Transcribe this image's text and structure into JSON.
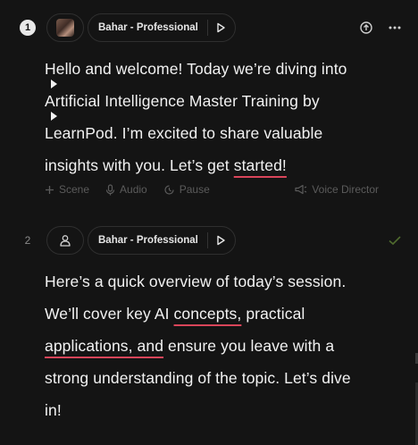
{
  "segments": [
    {
      "number": "1",
      "voice_label": "Bahar - Professional",
      "text_lines": [
        "Hello and welcome! Today we’re diving into",
        "Artificial Intelligence Master Training by",
        "LearnPod. I’m excited to share valuable",
        "insights with you. Let’s get "
      ],
      "underlined_word": "started!",
      "toolbar": {
        "scene_label": "Scene",
        "audio_label": "Audio",
        "pause_label": "Pause",
        "voice_director_label": "Voice Director"
      }
    },
    {
      "number": "2",
      "voice_label": "Bahar - Professional",
      "line1": "Here’s a quick overview of today’s session.",
      "line2_pre": "We’ll cover key AI ",
      "line2_ul": "concepts,",
      "line2_post": " practical",
      "line3_ul": "applications, and",
      "line3_post": " ensure you leave with a",
      "line4": "strong understanding of the topic. Let’s dive",
      "line5": "in!"
    }
  ],
  "colors": {
    "background": "#141414",
    "underline": "#d9455a",
    "check": "#4f6b2e"
  }
}
